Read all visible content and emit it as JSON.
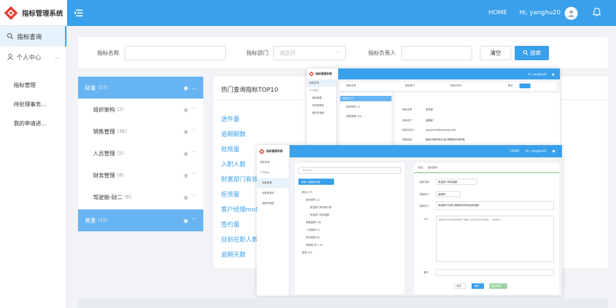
{
  "app": {
    "title": "指标管理系统"
  },
  "header": {
    "home": "HOME",
    "user": "Hi, yanghu20"
  },
  "sidebar": {
    "active": "指标查询",
    "group": "个人中心",
    "items": [
      "指标管理",
      "待处理事务...",
      "我的申请进..."
    ]
  },
  "filters": {
    "name_label": "指标名称",
    "dept_label": "指标部门",
    "dept_placeholder": "请选择",
    "owner_label": "指标负责人",
    "clear": "清空",
    "search": "搜索"
  },
  "tree": {
    "nodes": [
      {
        "label": "财富",
        "count": "(57)"
      },
      {
        "label": "组织架构",
        "count": "(2)"
      },
      {
        "label": "销售管理",
        "count": "(36)"
      },
      {
        "label": "人员管理",
        "count": "(5)"
      },
      {
        "label": "财务管理",
        "count": "(8)"
      },
      {
        "label": "驾驶舱-财二",
        "count": "(6)"
      },
      {
        "label": "普惠",
        "count": "(15)"
      }
    ]
  },
  "top10": {
    "title": "热门查询指标TOP10",
    "items": [
      "进件量",
      "逾期期数",
      "批核量",
      "入职人数",
      "财富部门有效",
      "拒货量",
      "客户经理mob",
      "签约量",
      "目前在职人数",
      "逾期天数"
    ]
  },
  "overlay1": {
    "title": "指标管理系统",
    "user": "Hi, yanghu20",
    "side": [
      "指标查询",
      "个人中心",
      "指标管理",
      "待处理事务",
      "我的申请进"
    ],
    "labels": [
      "指标名称",
      "指标部门",
      "指标负责人",
      "清空",
      "搜索"
    ],
    "tree": [
      "财富 (57)",
      "组织架构 (2)",
      "销售管理 (36)"
    ],
    "detail": [
      "指标名称",
      "指标部门",
      "指标负责人",
      "指标描述"
    ],
    "detail_values": [
      "进件量",
      "金服部",
      "yanghu20@vanrong.com",
      "指标计算时间点,统计周期内的进件数"
    ]
  },
  "overlay2": {
    "title": "指标管理系统",
    "home": "HOME",
    "user": "Hi, yanghu20",
    "side": [
      "指标查询",
      "个人中心",
      "指标管理",
      "待处理事务",
      "我的申请进"
    ],
    "search_placeholder": "搜索指标",
    "add_button": "添加一级指标分类",
    "tree": [
      "财富 (57)",
      "组织架构 (2)",
      "财富部门有效客户数",
      "财富部门有效金额",
      "销售管理 (36)",
      "人员管理 (5)",
      "财务管理 (8)",
      "驾驶舱-财二 (6)",
      "普惠 (15)"
    ],
    "tabs": [
      "财富",
      "组织架构"
    ],
    "form_labels": [
      "指标名称",
      "指标部门",
      "指标定义",
      "SQL",
      "备注"
    ],
    "form_values": [
      "财富部门有效金额",
      "金服部",
      "财富客户在统计周期内的有效投资金额"
    ],
    "sql": "select count(distinct dept_id) as amt from ... where ...",
    "buttons": [
      "清空",
      "保存",
      "提交审批"
    ]
  }
}
